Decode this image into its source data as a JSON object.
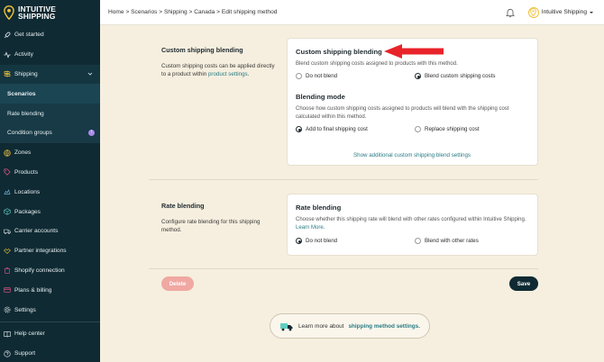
{
  "brand": {
    "line1": "INTUITIVE",
    "line2": "SHIPPING"
  },
  "sidebar": {
    "items": [
      {
        "label": "Get started",
        "icon": "rocket-icon"
      },
      {
        "label": "Activity",
        "icon": "pulse-icon"
      },
      {
        "label": "Shipping",
        "icon": "signpost-icon"
      },
      {
        "label": "Scenarios"
      },
      {
        "label": "Rate blending"
      },
      {
        "label": "Condition groups",
        "badge": "!"
      },
      {
        "label": "Zones",
        "icon": "globe-icon"
      },
      {
        "label": "Products",
        "icon": "tag-icon"
      },
      {
        "label": "Locations",
        "icon": "location-icon"
      },
      {
        "label": "Packages",
        "icon": "package-icon"
      },
      {
        "label": "Carrier accounts",
        "icon": "truck-icon"
      },
      {
        "label": "Partner integrations",
        "icon": "handshake-icon"
      },
      {
        "label": "Shopify connection",
        "icon": "shopping-bag-icon"
      },
      {
        "label": "Plans & billing",
        "icon": "credit-card-icon"
      },
      {
        "label": "Settings",
        "icon": "gear-icon"
      }
    ],
    "footer": [
      {
        "label": "Help center",
        "icon": "book-icon"
      },
      {
        "label": "Support",
        "icon": "question-icon"
      }
    ]
  },
  "breadcrumb": [
    "Home",
    "Scenarios",
    "Shipping",
    "Canada",
    "Edit shipping method"
  ],
  "user": {
    "name": "Intuitive Shipping"
  },
  "custom_section": {
    "title": "Custom shipping blending",
    "desc": "Custom shipping costs can be applied directly to a product within",
    "link": "product settings",
    "link_suffix": "."
  },
  "custom_card": {
    "title": "Custom shipping blending",
    "desc": "Blend custom shipping costs assigned to products with this method.",
    "opt1": "Do not blend",
    "opt2": "Blend custom shipping costs",
    "mode_title": "Blending mode",
    "mode_desc": "Choose how custom shipping costs assigned to products will blend with the shipping cost calculated within this method.",
    "mode_opt1": "Add to final shipping cost",
    "mode_opt2": "Replace shipping cost",
    "show_link": "Show additional custom shipping blend settings"
  },
  "rate_section": {
    "title": "Rate blending",
    "desc": "Configure rate blending for this shipping method."
  },
  "rate_card": {
    "title": "Rate blending",
    "desc": "Choose whether this shipping rate will blend with other rates configured within Intuitive Shipping.",
    "learn": "Learn More.",
    "opt1": "Do not blend",
    "opt2": "Blend with other rates"
  },
  "actions": {
    "delete": "Delete",
    "save": "Save"
  },
  "learn_more": {
    "prefix": "Learn more about",
    "link": "shipping method settings."
  },
  "colors": {
    "sidebar": "#0f2a33",
    "accent": "#2b7c85",
    "brand_yellow": "#f0c23a",
    "arrow": "#e8232a",
    "delete": "#f0a8a2"
  }
}
